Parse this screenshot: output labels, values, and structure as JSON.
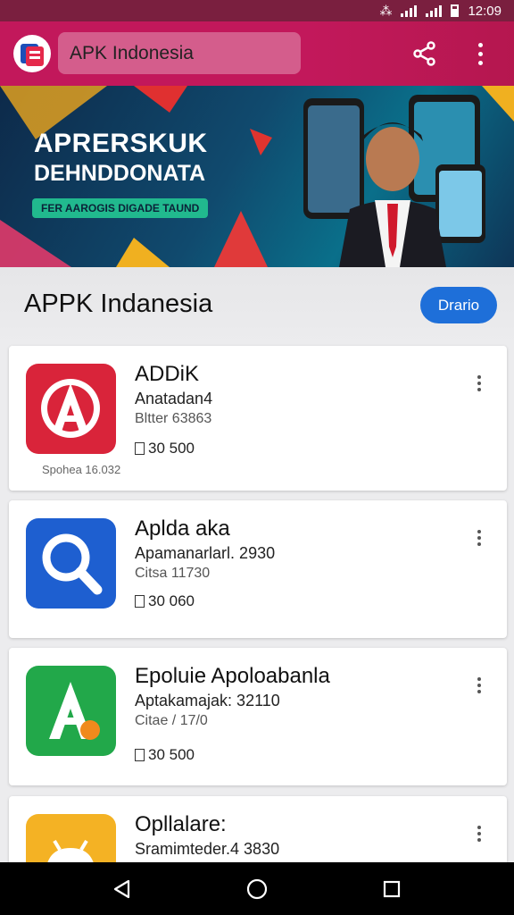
{
  "status_bar": {
    "time": "12:09",
    "icons": [
      "mute-icon",
      "signal-icon",
      "signal-icon",
      "battery-icon"
    ]
  },
  "app_bar": {
    "logo_icon": "apk-logo-icon",
    "search_value": "APK Indonesia",
    "share_icon": "share-icon",
    "menu_icon": "more-vertical-icon"
  },
  "banner": {
    "headline_1": "APRERSKUK",
    "headline_2": "DEHNDDONATA",
    "tagline": "FER AAROGIS DIGADE TAUND"
  },
  "section": {
    "title": "APPK Indanesia",
    "button_label": "Drario"
  },
  "apps": [
    {
      "name": "ADDiK",
      "developer": "Anatadan4",
      "meta": "Bltter 63863",
      "size": "30 500",
      "updated": "Spohea 16.032",
      "icon": "letter-a-icon",
      "icon_color": "#d9243a"
    },
    {
      "name": "Aplda aka",
      "developer": "Apamanarlarl. 2930",
      "meta": "Citsa 11730",
      "size": "30 060",
      "updated": "",
      "icon": "magnifier-icon",
      "icon_color": "#1e5fd0"
    },
    {
      "name": "Epoluie Apoloabanla",
      "developer": "Aptakamajak: 32110",
      "meta": "Citae / 17/0",
      "size": "30 500",
      "updated": "",
      "icon": "letter-a-icon",
      "icon_color": "#22a84a"
    },
    {
      "name": "Opllalare:",
      "developer": "Sramimteder.4 3830",
      "meta": "",
      "size": "",
      "updated": "",
      "icon": "android-icon",
      "icon_color": "#f4b224"
    }
  ],
  "nav_bar": {
    "back_icon": "back-icon",
    "home_icon": "home-icon",
    "recents_icon": "recents-icon"
  }
}
